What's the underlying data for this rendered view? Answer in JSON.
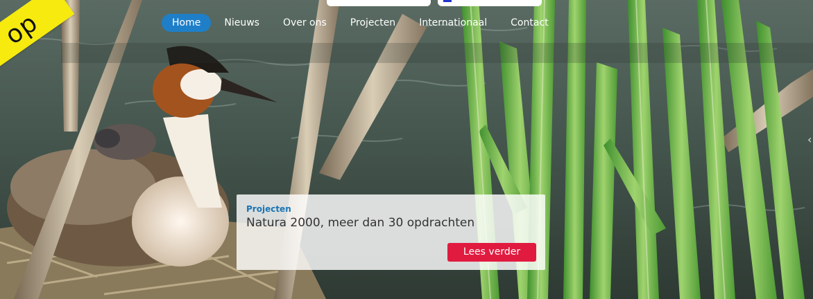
{
  "nav": {
    "items": [
      {
        "label": "Home",
        "active": true
      },
      {
        "label": "Nieuws"
      },
      {
        "label": "Over ons"
      },
      {
        "label": "Projecten"
      },
      {
        "label": "Internationaal"
      },
      {
        "label": "Contact"
      }
    ]
  },
  "ribbon": {
    "text": "op"
  },
  "slide": {
    "category": "Projecten",
    "title": "Natura 2000, meer dan 30 opdrachten",
    "button_label": "Lees verder"
  },
  "colors": {
    "nav_active": "#1e7fc8",
    "button": "#e11b3f",
    "category_text": "#1b74b5",
    "ribbon": "#f6ea0f"
  },
  "hero_image": "great-crested-grebe-on-nest-among-reeds"
}
